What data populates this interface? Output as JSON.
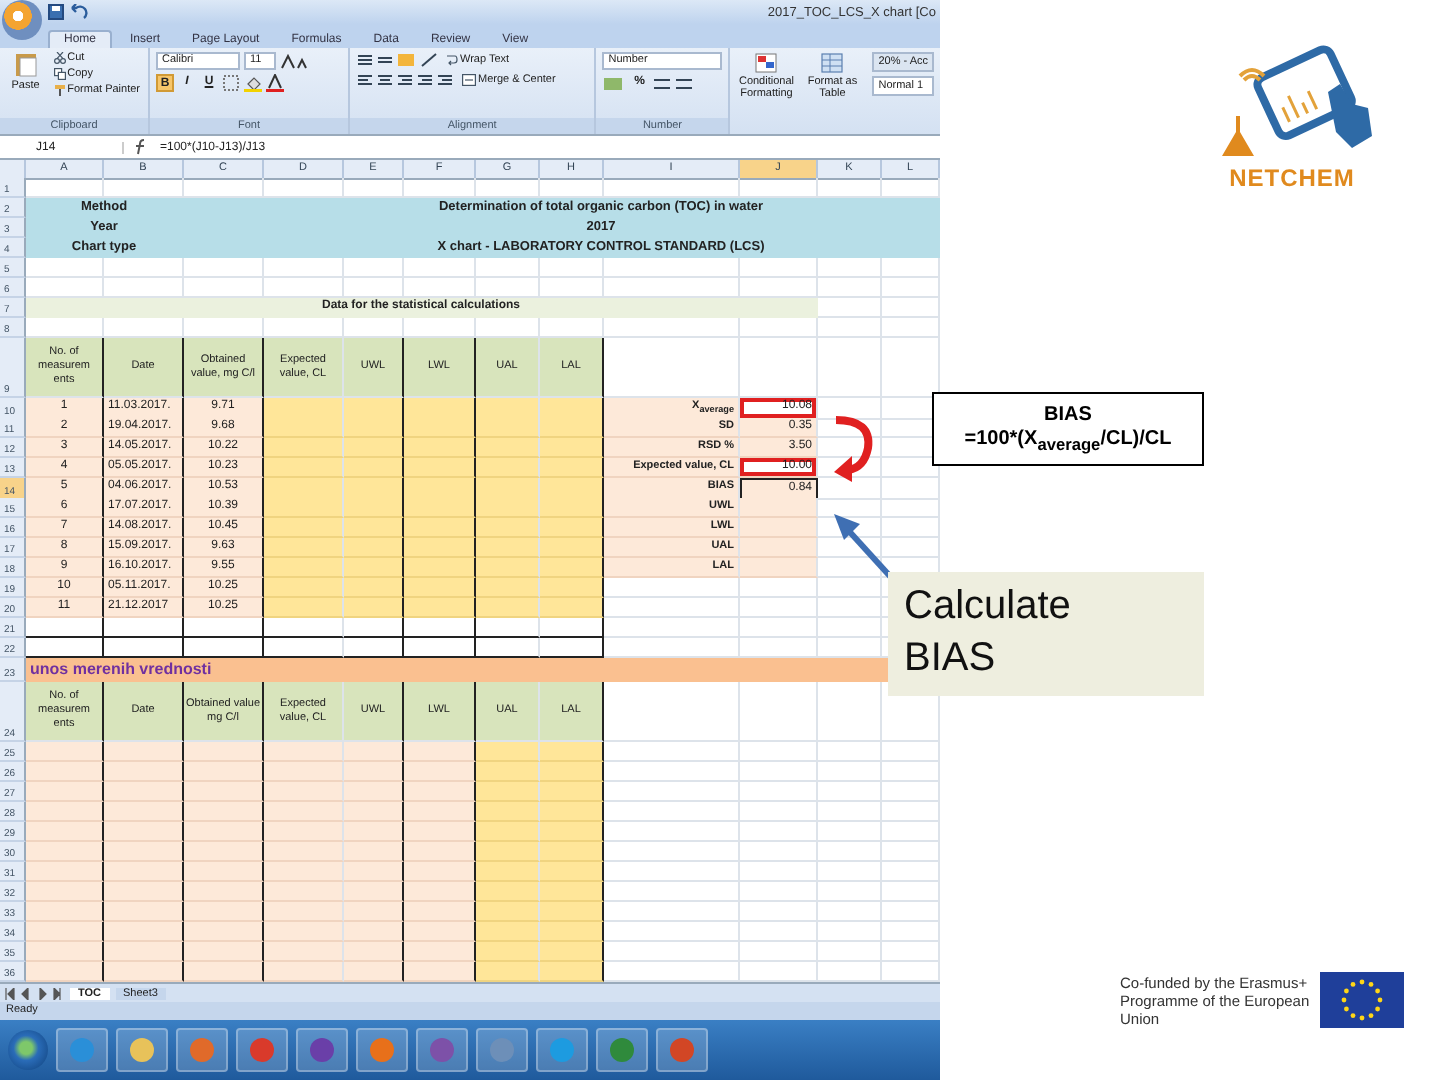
{
  "window": {
    "title": "2017_TOC_LCS_X chart [Co"
  },
  "ribbon": {
    "tabs": [
      {
        "label": "Home",
        "selected": true
      },
      {
        "label": "Insert",
        "selected": false
      },
      {
        "label": "Page Layout",
        "selected": false
      },
      {
        "label": "Formulas",
        "selected": false
      },
      {
        "label": "Data",
        "selected": false
      },
      {
        "label": "Review",
        "selected": false
      },
      {
        "label": "View",
        "selected": false
      }
    ],
    "clipboard": {
      "paste": "Paste",
      "cut": "Cut",
      "copy": "Copy",
      "format_painter": "Format Painter",
      "label": "Clipboard"
    },
    "font": {
      "name": "Calibri",
      "size": "11",
      "bold": "B",
      "italic": "I",
      "underline": "U",
      "label": "Font"
    },
    "alignment": {
      "wrap": "Wrap Text",
      "merge": "Merge & Center",
      "label": "Alignment"
    },
    "number": {
      "format": "Number",
      "percent": "%",
      "label": "Number"
    },
    "styles": {
      "conditional": "Conditional Formatting",
      "format_table": "Format as Table",
      "style_1": "20% - Acc",
      "style_2": "Normal 1"
    }
  },
  "formula_bar": {
    "name_box": "J14",
    "formula": "=100*(J10-J13)/J13"
  },
  "columns": [
    {
      "label": "A",
      "selected": false
    },
    {
      "label": "B",
      "selected": false
    },
    {
      "label": "C",
      "selected": false
    },
    {
      "label": "D",
      "selected": false
    },
    {
      "label": "E",
      "selected": false
    },
    {
      "label": "F",
      "selected": false
    },
    {
      "label": "G",
      "selected": false
    },
    {
      "label": "H",
      "selected": false
    },
    {
      "label": "I",
      "selected": false
    },
    {
      "label": "J",
      "selected": true
    },
    {
      "label": "K",
      "selected": false
    },
    {
      "label": "L",
      "selected": false
    }
  ],
  "rows": [
    {
      "n": "1",
      "kind": "blank"
    },
    {
      "n": "2",
      "kind": "banner",
      "label": "Method",
      "value": "Determination of total organic carbon (TOC) in water"
    },
    {
      "n": "3",
      "kind": "banner",
      "label": "Year",
      "value": "2017"
    },
    {
      "n": "4",
      "kind": "banner",
      "label": "Chart type",
      "value": "X chart - LABORATORY CONTROL STANDARD (LCS)"
    },
    {
      "n": "5",
      "kind": "blank"
    },
    {
      "n": "6",
      "kind": "blank"
    },
    {
      "n": "7",
      "kind": "section",
      "text": "Data for the statistical calculations"
    },
    {
      "n": "8",
      "kind": "blank"
    },
    {
      "n": "9",
      "kind": "header",
      "cells": [
        "No. of measurem ents",
        "Date",
        "Obtained value, mg C/l",
        "Expected value, CL",
        "UWL",
        "LWL",
        "UAL",
        "LAL"
      ]
    },
    {
      "n": "10",
      "kind": "data",
      "cells": [
        "1",
        "11.03.2017.",
        "9.71"
      ],
      "stat": {
        "label": "X$_{average}$",
        "value": "10.08",
        "selected": false,
        "highlighted": true
      }
    },
    {
      "n": "11",
      "kind": "data",
      "cells": [
        "2",
        "19.04.2017.",
        "9.68"
      ],
      "stat": {
        "label": "SD",
        "value": "0.35",
        "selected": false,
        "highlighted": false
      }
    },
    {
      "n": "12",
      "kind": "data",
      "cells": [
        "3",
        "14.05.2017.",
        "10.22"
      ],
      "stat": {
        "label": "RSD %",
        "value": "3.50",
        "selected": false,
        "highlighted": false
      }
    },
    {
      "n": "13",
      "kind": "data",
      "cells": [
        "4",
        "05.05.2017.",
        "10.23"
      ],
      "stat": {
        "label": "Expected value, CL",
        "value": "10.00",
        "selected": false,
        "highlighted": true
      }
    },
    {
      "n": "14",
      "kind": "data",
      "cells": [
        "5",
        "04.06.2017.",
        "10.53"
      ],
      "stat": {
        "label": "BIAS",
        "value": "0.84",
        "selected": true,
        "highlighted": false
      }
    },
    {
      "n": "15",
      "kind": "data",
      "cells": [
        "6",
        "17.07.2017.",
        "10.39"
      ],
      "stat": {
        "label": "UWL",
        "selected": false,
        "highlighted": false
      }
    },
    {
      "n": "16",
      "kind": "data",
      "cells": [
        "7",
        "14.08.2017.",
        "10.45"
      ],
      "stat": {
        "label": "LWL",
        "selected": false,
        "highlighted": false
      }
    },
    {
      "n": "17",
      "kind": "data",
      "cells": [
        "8",
        "15.09.2017.",
        "9.63"
      ],
      "stat": {
        "label": "UAL",
        "selected": false,
        "highlighted": false
      }
    },
    {
      "n": "18",
      "kind": "data",
      "cells": [
        "9",
        "16.10.2017.",
        "9.55"
      ],
      "stat": {
        "label": "LAL",
        "selected": false,
        "highlighted": false
      }
    },
    {
      "n": "19",
      "kind": "data",
      "cells": [
        "10",
        "05.11.2017.",
        "10.25"
      ]
    },
    {
      "n": "20",
      "kind": "data",
      "cells": [
        "11",
        "21.12.2017",
        "10.25"
      ]
    },
    {
      "n": "21",
      "kind": "empty"
    },
    {
      "n": "22",
      "kind": "empty"
    },
    {
      "n": "23",
      "kind": "entry-title",
      "text": "unos merenih vrednosti"
    },
    {
      "n": "24",
      "kind": "header",
      "cells": [
        "No. of measurem ents",
        "Date",
        "Obtained value mg C/l",
        "Expected value, CL",
        "UWL",
        "LWL",
        "UAL",
        "LAL"
      ]
    },
    {
      "n": "25",
      "kind": "entry"
    },
    {
      "n": "26",
      "kind": "entry"
    },
    {
      "n": "27",
      "kind": "entry"
    },
    {
      "n": "28",
      "kind": "entry"
    },
    {
      "n": "29",
      "kind": "entry"
    },
    {
      "n": "30",
      "kind": "entry"
    },
    {
      "n": "31",
      "kind": "entry"
    },
    {
      "n": "32",
      "kind": "entry"
    },
    {
      "n": "33",
      "kind": "entry"
    },
    {
      "n": "34",
      "kind": "entry"
    },
    {
      "n": "35",
      "kind": "entry"
    },
    {
      "n": "36",
      "kind": "entry"
    }
  ],
  "sheet_tabs": [
    {
      "label": "TOC",
      "selected": true
    },
    {
      "label": "Sheet3",
      "selected": false
    }
  ],
  "status": "Ready",
  "annotation": {
    "title": "BIAS",
    "formula": "=100*(X$_{average}$/CL)/CL"
  },
  "callout": "Calculate BIAS",
  "logo": "NETCHEM",
  "eu_notice": "Co-funded by the Erasmus+ Programme of the European Union"
}
